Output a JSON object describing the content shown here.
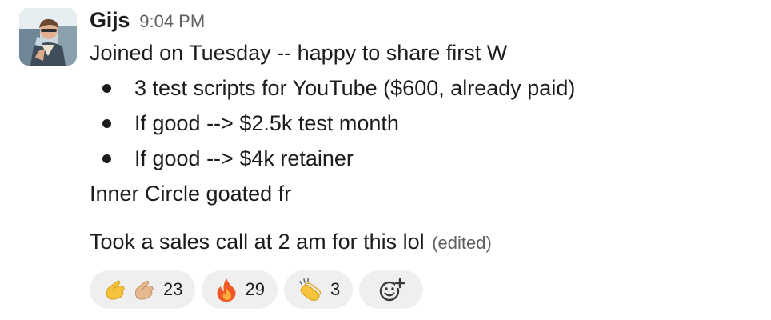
{
  "message": {
    "author": "Gijs",
    "timestamp": "9:04 PM",
    "line1": "Joined on Tuesday -- happy to share first W",
    "bullets": [
      "3 test scripts for YouTube ($600, already paid)",
      "If good --> $2.5k test month",
      "If good --> $4k retainer"
    ],
    "line2": "Inner Circle goated fr",
    "line3": "Took a sales call at 2 am for this lol",
    "edited": "(edited)"
  },
  "reactions": [
    {
      "emoji": [
        "pinched-fingers-icon",
        "pinched-fingers-light-skin-icon"
      ],
      "count": "23"
    },
    {
      "emoji": [
        "fire-icon"
      ],
      "count": "29"
    },
    {
      "emoji": [
        "clapping-hands-icon"
      ],
      "count": "3"
    }
  ],
  "add_reaction": {
    "icon": "add-reaction-icon"
  }
}
